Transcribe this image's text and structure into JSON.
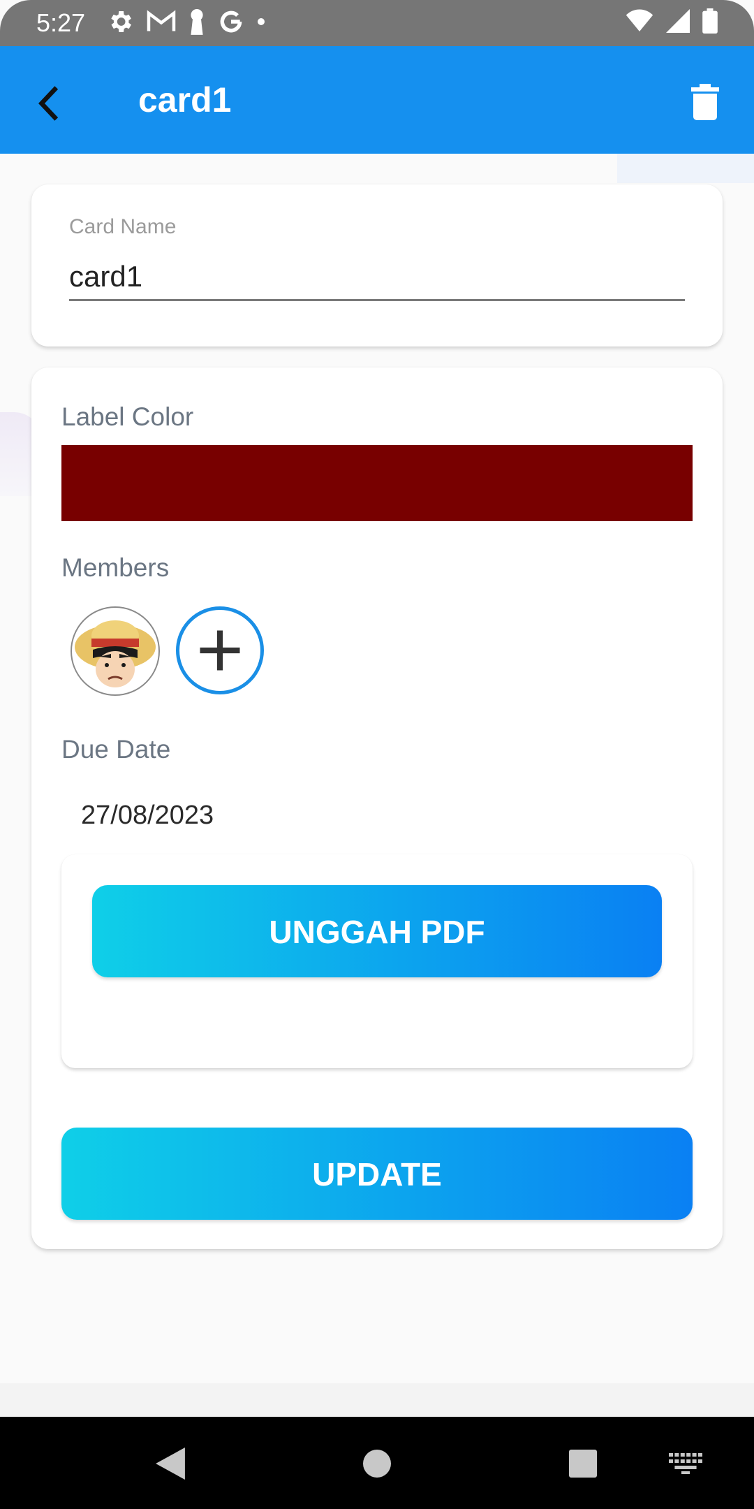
{
  "status_bar": {
    "time": "5:27",
    "left_icons": [
      "gear-icon",
      "gmail-icon",
      "keyhole-icon",
      "google-icon",
      "dot-icon"
    ],
    "right_icons": [
      "wifi-icon",
      "signal-icon",
      "battery-icon"
    ]
  },
  "app_bar": {
    "title": "card1",
    "back_icon": "back-arrow-icon",
    "delete_icon": "trash-icon",
    "background_color": "#1590ef"
  },
  "card_name": {
    "label": "Card Name",
    "value": "card1"
  },
  "label_color": {
    "label": "Label Color",
    "color": "#780000"
  },
  "members": {
    "label": "Members",
    "items": [
      {
        "avatar_icon": "member-avatar-icon"
      }
    ],
    "add_icon": "plus-icon"
  },
  "due_date": {
    "label": "Due Date",
    "value": "27/08/2023"
  },
  "buttons": {
    "upload_pdf": "UNGGAH PDF",
    "update": "UPDATE"
  },
  "nav_bar": {
    "icons": [
      "back-triangle-icon",
      "home-circle-icon",
      "recents-square-icon",
      "keyboard-icon"
    ]
  }
}
